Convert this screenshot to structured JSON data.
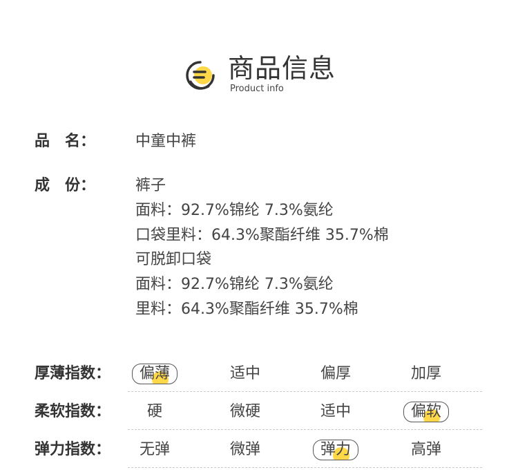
{
  "header": {
    "icon": "document-lines-icon",
    "title": "商品信息",
    "subtitle": "Product info",
    "accent_color": "#ffd84a"
  },
  "name": {
    "label": "品　名：",
    "value": "中童中裤"
  },
  "composition": {
    "label": "成　份：",
    "lines": [
      "裤子",
      "面料：92.7%锦纶 7.3%氨纶",
      "口袋里料：64.3%聚酯纤维 35.7%棉",
      "可脱卸口袋",
      "面料：92.7%锦纶 7.3%氨纶",
      "里料：64.3%聚酯纤维 35.7%棉"
    ]
  },
  "indices": [
    {
      "label": "厚薄指数：",
      "options": [
        "偏薄",
        "适中",
        "偏厚",
        "加厚"
      ],
      "selected": "偏薄"
    },
    {
      "label": "柔软指数：",
      "options": [
        "硬",
        "微硬",
        "适中",
        "偏软"
      ],
      "selected": "偏软"
    },
    {
      "label": "弹力指数：",
      "options": [
        "无弹",
        "微弹",
        "弹力",
        "高弹"
      ],
      "selected": "弹力"
    }
  ]
}
